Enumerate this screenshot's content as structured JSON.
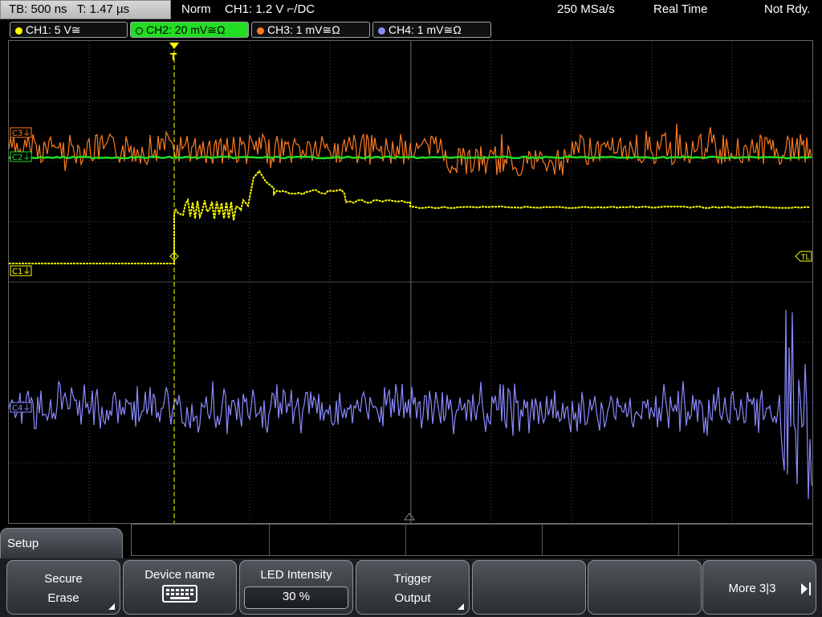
{
  "status": {
    "timebase": "TB: 500 ns   T: 1.47 µs",
    "mode": "Norm",
    "trigger": "CH1: 1.2 V ⌐/DC",
    "sample_rate": "250 MSa/s",
    "acq": "Real Time",
    "state": "Not Rdy."
  },
  "channels": [
    {
      "label": "CH1: 5 V≅",
      "color": "#ffff00"
    },
    {
      "label": "CH2: 20 mV≅Ω",
      "color": "#22dd22",
      "active": true
    },
    {
      "label": "CH3: 1 mV≅Ω",
      "color": "#ff7a20"
    },
    {
      "label": "CH4: 1 mV≅Ω",
      "color": "#8a8aff"
    }
  ],
  "markers": {
    "c1": "C1⏚",
    "c3": "C3⏚",
    "c4": "C4⏚",
    "c2": "C2⏚",
    "tl": "TL",
    "trig": "T"
  },
  "menu": {
    "title": "Setup",
    "keys": [
      {
        "line1": "Secure",
        "line2": "Erase"
      },
      {
        "line1": "Device name"
      },
      {
        "line1": "LED Intensity",
        "value": "30 %"
      },
      {
        "line1": "Trigger",
        "line2": "Output"
      },
      {
        "line1": ""
      },
      {
        "line1": ""
      },
      {
        "line1": "More 3|3"
      }
    ]
  },
  "colors": {
    "ch1": "#ffff00",
    "ch2": "#22dd22",
    "ch3": "#ff7a20",
    "ch4": "#8a8aff",
    "grid": "#4a4a4a"
  }
}
